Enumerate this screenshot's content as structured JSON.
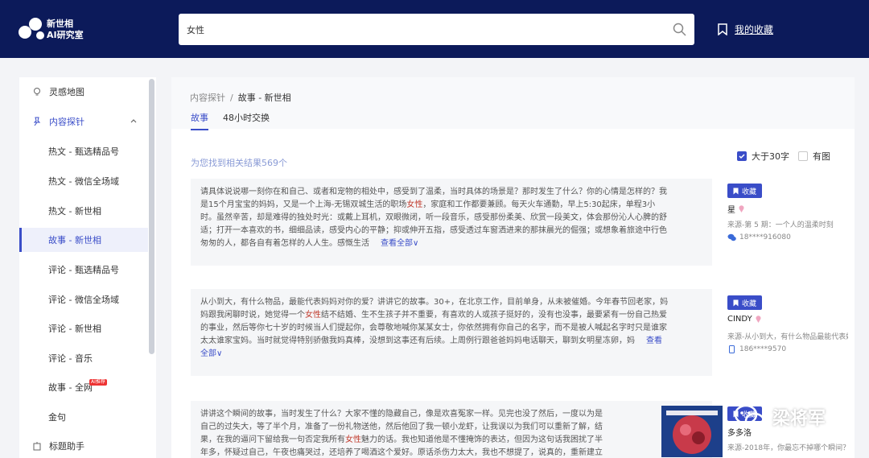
{
  "header": {
    "logo_line1": "新世相",
    "logo_line2": "AI研究室",
    "search_value": "女性",
    "favorites_label": "我的收藏"
  },
  "sidebar": {
    "items": [
      {
        "label": "灵感地图"
      },
      {
        "label": "内容探针"
      },
      {
        "label": "热文 - 甄选精品号"
      },
      {
        "label": "热文 - 微信全场域"
      },
      {
        "label": "热文 - 新世相"
      },
      {
        "label": "故事 - 新世相"
      },
      {
        "label": "评论 - 甄选精品号"
      },
      {
        "label": "评论 - 微信全场域"
      },
      {
        "label": "评论 - 新世相"
      },
      {
        "label": "评论 - 音乐"
      },
      {
        "label": "故事 - 全网",
        "badge": "AI推荐"
      },
      {
        "label": "金句"
      },
      {
        "label": "标题助手"
      }
    ]
  },
  "main": {
    "breadcrumb_parent": "内容探针",
    "breadcrumb_sep": "/",
    "breadcrumb_current": "故事 - 新世相",
    "tabs": [
      {
        "label": "故事"
      },
      {
        "label": "48小时交换"
      }
    ],
    "result_count": "为您找到相关结果569个",
    "filters": [
      {
        "label": "大于30字",
        "checked": true
      },
      {
        "label": "有图",
        "checked": false
      }
    ],
    "cards": [
      {
        "lines": [
          [
            "请具体说说哪一刻你在和自己、或者和宠物的相处中，感受到了温柔，当时具体的场景是？那时发生了什么？你的心情是怎样的？我"
          ],
          [
            "是15个月宝宝的妈妈，又是一个上海-无锡双城生活的职场",
            {
              "hl": "女性"
            },
            "，家庭和工作都要兼顾。每天火车通勤，早上5:30起床，单程3小"
          ],
          [
            "时。虽然辛苦，却是难得的独处时光：或戴上耳机，双眼微闭，听一段音乐，感受那份柔美、欣赏一段美文，体会那份沁人心脾的舒"
          ],
          [
            "适；打开一本喜欢的书，细细品读，感受内心的平静；抑或伸开五指，感受透过车窗洒进来的那抹晨光的倔强；或想象着旅途中行色"
          ],
          [
            "匆匆的人，都各自有着怎样的人人生。感慨生活"
          ]
        ],
        "more": "查看全部",
        "fav_label": "收藏",
        "author": "星",
        "source": "来源-第 5 期：一个人的温柔时刻",
        "contact": "18****916080"
      },
      {
        "lines": [
          [
            "从小到大，有什么物品，最能代表妈妈对你的爱？讲讲它的故事。30+，在北京工作，目前单身，从未被催婚。今年春节回老家，妈"
          ],
          [
            "妈跟我闲聊时说，她觉得一个",
            {
              "hl": "女性"
            },
            "结不结婚、生不生孩子并不重要，有喜欢的人或孩子挺好的，没有也没事，最要紧有一份自己热爱"
          ],
          [
            "的事业，然后等你七十岁的时候当人们提起你，会尊敬地喊你某某女士，你依然拥有你自己的名字，而不是被人喊起名字时只是谁家"
          ],
          [
            "太太谁家宝妈。当时就觉得特别骄傲我妈真棒，没想到这事还有后续。上周例行跟爸爸妈妈电话聊天，聊到女明星冻卵，妈"
          ],
          [
            "全部"
          ]
        ],
        "more": "查看",
        "fav_label": "收藏",
        "author": "CINDY",
        "source": "来源-从小到大，有什么物品最能代表妈妈对你的爱？",
        "contact": "186****9570"
      },
      {
        "lines": [
          [
            "讲讲这个瞬间的故事，当时发生了什么？大家不懂的隐藏自己，像是欢喜冤家一样。见完也没了然后，一度以为是"
          ],
          [
            "自己的过失大，等了半个月，准备了一份礼物送他，然后他回了我一顿小龙虾，让我误以为我们可以重新了解，结"
          ],
          [
            "果，在我的逼问下留给我一句否定我所有",
            {
              "hl": "女性"
            },
            "魅力的话。我也知道他是不懂掩饰的表达，但因为这句话我困扰了半"
          ],
          [
            "年多，怀疑过自己，午夜也痛哭过，还培养了喝酒这个爱好。原话杀伤力太大，我也不想提了，说真的，重新建立"
          ]
        ],
        "fav_label": "收藏",
        "author": "多多洛",
        "source": "来源-2018年，你最忘不掉哪个瞬间？"
      }
    ]
  },
  "watermark": "梁将军",
  "colors": {
    "header_bg": "#0c1a5a",
    "accent": "#3a4dc8",
    "highlight": "#c0392b"
  }
}
